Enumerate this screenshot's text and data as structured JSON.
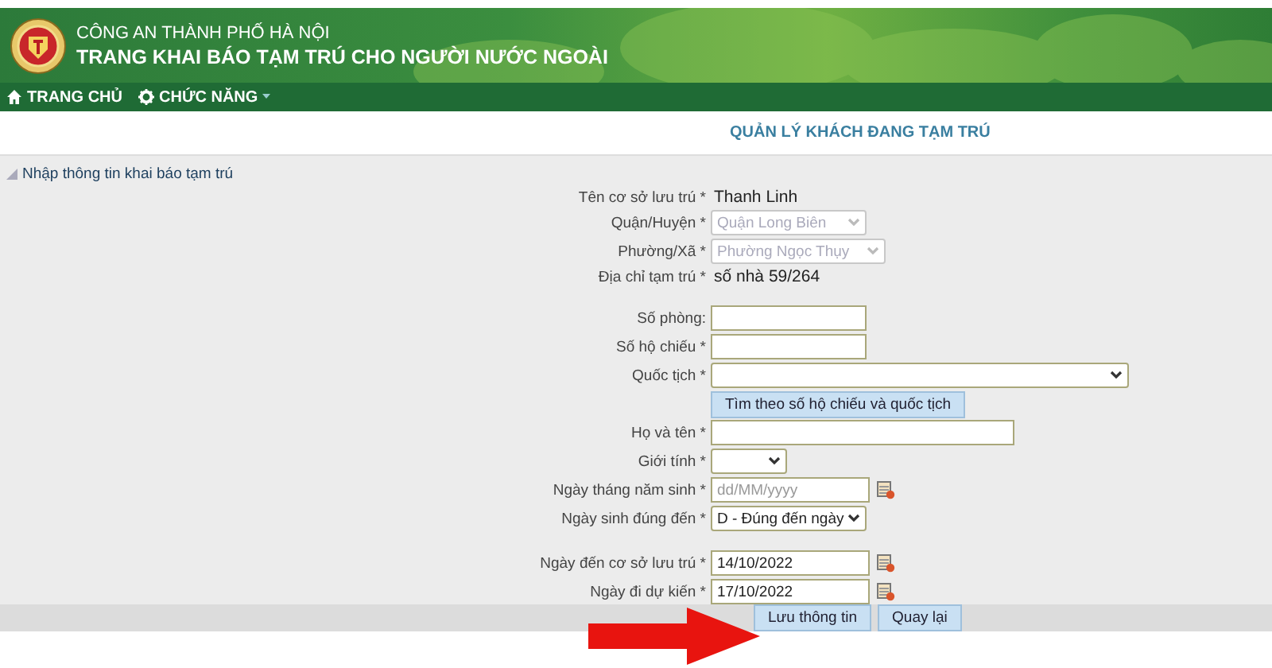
{
  "header": {
    "org": "CÔNG AN THÀNH PHỐ HÀ NỘI",
    "title": "TRANG KHAI BÁO TẠM TRÚ CHO NGƯỜI NƯỚC NGOÀI"
  },
  "nav": [
    {
      "label": "TRANG CHỦ"
    },
    {
      "label": "CHỨC NĂNG"
    }
  ],
  "page_title": "QUẢN LÝ KHÁCH ĐANG TẠM TRÚ",
  "section_title": "Nhập thông tin khai báo tạm trú",
  "groups": [
    [
      {
        "kind": "text",
        "label": "Tên cơ sở lưu trú *",
        "value": "Thanh Linh"
      },
      {
        "kind": "select",
        "label": "Quận/Huyện *",
        "value": "Quận Long Biên",
        "disabled": true
      },
      {
        "kind": "select",
        "label": "Phường/Xã *",
        "value": "Phường Ngọc Thụy",
        "disabled": true
      },
      {
        "kind": "text",
        "label": "Địa chỉ tạm trú *",
        "value": "số nhà 59/264"
      }
    ],
    [
      {
        "kind": "input",
        "label": "Số phòng:"
      },
      {
        "kind": "input",
        "label": "Số hộ chiếu *"
      },
      {
        "kind": "select",
        "label": "Quốc tịch *",
        "disabled": false
      },
      {
        "kind": "button",
        "label": "Tìm theo số hộ chiếu và quốc tịch"
      },
      {
        "kind": "input",
        "label": "Họ và tên *"
      },
      {
        "kind": "select",
        "label": "Giới tính *",
        "disabled": false
      },
      {
        "kind": "date",
        "label": "Ngày tháng năm sinh *",
        "placeholder": "dd/MM/yyyy"
      },
      {
        "kind": "select",
        "label": "Ngày sinh đúng đến *",
        "value": "D - Đúng đến ngày",
        "disabled": false
      }
    ],
    [
      {
        "kind": "date",
        "label": "Ngày đến cơ sở lưu trú *",
        "value": "14/10/2022"
      },
      {
        "kind": "date",
        "label": "Ngày đi dự kiến *",
        "value": "17/10/2022"
      }
    ]
  ],
  "buttons": [
    "Lưu thông tin",
    "Quay lại"
  ]
}
